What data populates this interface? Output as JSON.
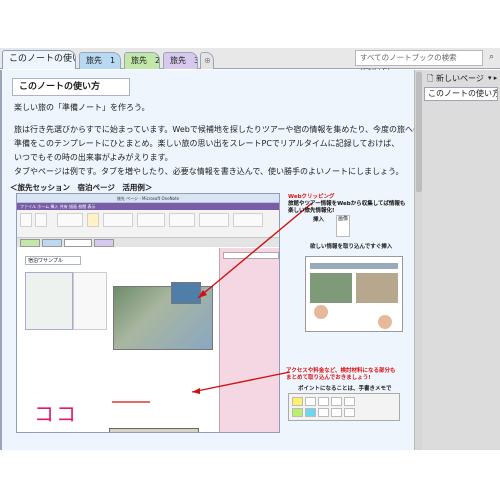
{
  "tabs": {
    "active": "このノートの使い方",
    "trip1": "旅先　1",
    "trip2": "旅先　2",
    "trip3": "旅先　3",
    "add": "⊕"
  },
  "search": {
    "placeholder": "すべてのノートブックの検索 (Ctrl+E)"
  },
  "pages_pane": {
    "new_page": "新しいページ",
    "arrows": "▾ ▸",
    "items": [
      "このノートの使い方"
    ]
  },
  "page": {
    "title": "このノートの使い方",
    "lines": [
      "楽しい旅の「準備ノート」を作ろう。",
      "旅は行き先選びからすでに始まっています。Webで候補地を探したりツアーや宿の情報を集めたり、今度の旅への思いと",
      "準備をこのテンプレートにひとまとめ。楽しい旅の思い出をスレートPCでリアルタイムに記録しておけば、",
      "いつでもその時の出来事がよみがえります。",
      "タブやページは例です。タブを増やしたり、必要な情報を書き込んで、使い勝手のよいノートにしましょう。"
    ],
    "section_caption": "＜旅先セッション　宿泊ページ　活用例＞"
  },
  "screenshot": {
    "window_title": "旅先 ページ - Microsoft OneNote",
    "menu": "ファイル  ホーム  挿入  共有  描画  校閲  表示",
    "inner_title": "宿泊ワサンプル",
    "koko": "ココ"
  },
  "annotations": {
    "web_clip_title": "Webクリッピング",
    "web_clip_text": "旅館やツアー情報をWebから収集してば情報も 楽しい旅先情報化!",
    "insert_label": "挿入",
    "insert_icon": "画像",
    "paste_text": "欲しい情報を取り込んですぐ挿入",
    "access_text_1": "アクセスや料金など、検討材料になる部分も",
    "access_text_2": "まとめて取り込んでおきましょう!",
    "point_text": "ポイントになることは、手書きメモで"
  },
  "colors": {
    "tab_blue": "#b9d9f2",
    "tab_green": "#c2e7a9",
    "tab_purple": "#d7c9ee",
    "page_bg": "#eef5fc",
    "koko": "#e0196f",
    "arrow": "#d11111"
  }
}
